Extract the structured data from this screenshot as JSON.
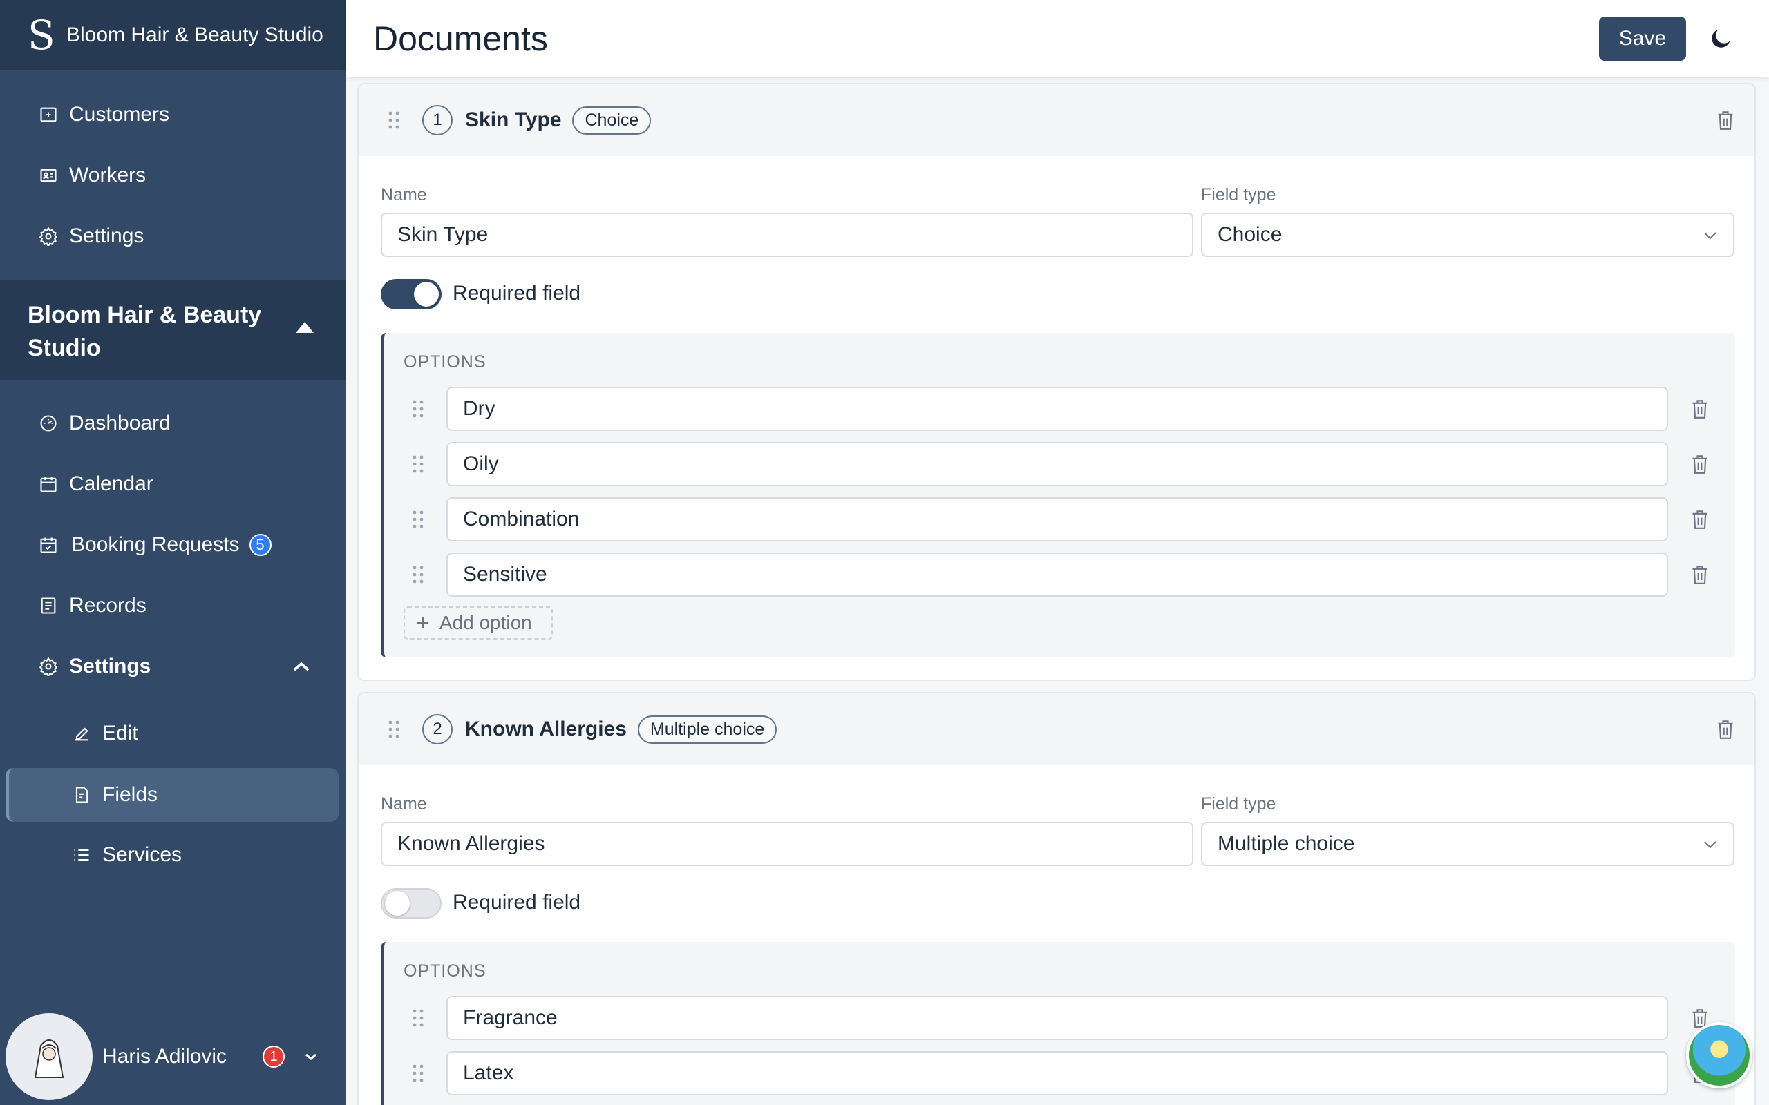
{
  "brand": {
    "logo": "S",
    "name": "Bloom Hair & Beauty Studio"
  },
  "top_nav": [
    {
      "label": "Customers",
      "icon": "building-icon"
    },
    {
      "label": "Workers",
      "icon": "id-card-icon"
    },
    {
      "label": "Settings",
      "icon": "gear-icon"
    }
  ],
  "studio": {
    "name": "Bloom Hair & Beauty Studio"
  },
  "studio_nav": [
    {
      "label": "Dashboard",
      "icon": "gauge-icon"
    },
    {
      "label": "Calendar",
      "icon": "calendar-icon"
    },
    {
      "label": "Booking Requests",
      "icon": "calendar-check-icon",
      "badge": "5"
    },
    {
      "label": "Records",
      "icon": "records-icon"
    },
    {
      "label": "Settings",
      "icon": "gear-icon"
    }
  ],
  "settings_sub": [
    {
      "label": "Edit",
      "icon": "pencil-icon"
    },
    {
      "label": "Fields",
      "icon": "document-icon",
      "active": true
    },
    {
      "label": "Services",
      "icon": "list-icon"
    }
  ],
  "user": {
    "name": "Haris Adilovic",
    "notifications": "1"
  },
  "header": {
    "title": "Documents",
    "save_label": "Save"
  },
  "fields": [
    {
      "number": "1",
      "title": "Skin Type",
      "type_chip": "Choice",
      "name_label": "Name",
      "name_value": "Skin Type",
      "type_label": "Field type",
      "type_value": "Choice",
      "required_label": "Required field",
      "required": true,
      "options_title": "OPTIONS",
      "options": [
        "Dry",
        "Oily",
        "Combination",
        "Sensitive"
      ],
      "add_option_label": "Add option"
    },
    {
      "number": "2",
      "title": "Known Allergies",
      "type_chip": "Multiple choice",
      "name_label": "Name",
      "name_value": "Known Allergies",
      "type_label": "Field type",
      "type_value": "Multiple choice",
      "required_label": "Required field",
      "required": false,
      "options_title": "OPTIONS",
      "options": [
        "Fragrance",
        "Latex"
      ]
    }
  ],
  "colors": {
    "sidebar": "#324a68",
    "sidebar_dark": "#263a54",
    "accent": "#324a68",
    "badge_blue": "#2e7cf6",
    "badge_red": "#e53935"
  }
}
